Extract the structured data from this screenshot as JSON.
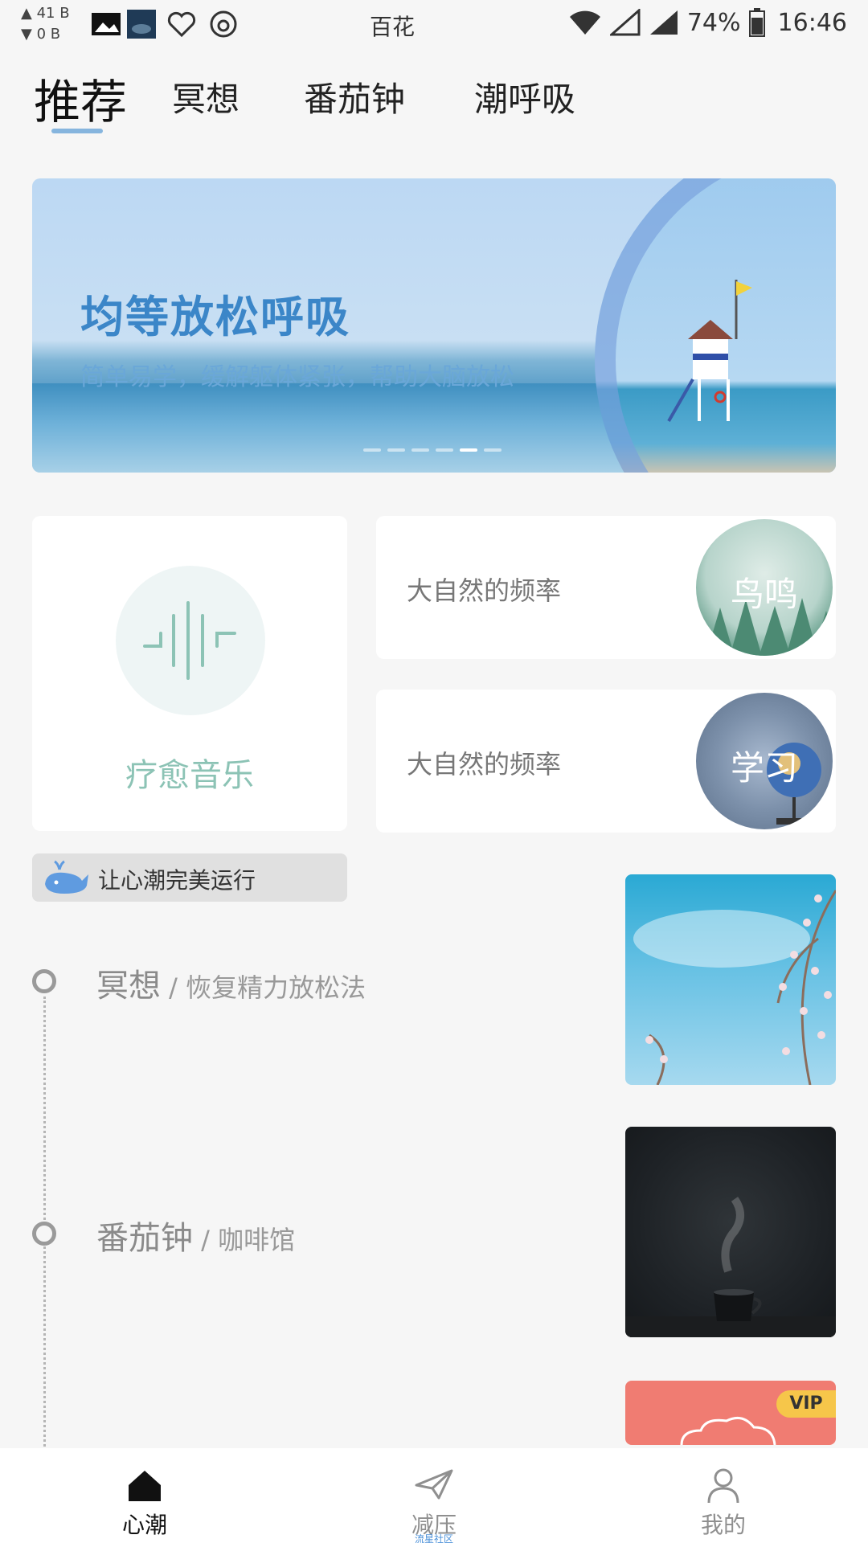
{
  "status_bar": {
    "net_up": "41 B",
    "net_down": "0 B",
    "center_label": "百花",
    "battery": "74%",
    "time": "16:46"
  },
  "tabs": [
    {
      "label": "推荐",
      "active": true
    },
    {
      "label": "冥想",
      "active": false
    },
    {
      "label": "番茄钟",
      "active": false
    },
    {
      "label": "潮呼吸",
      "active": false
    }
  ],
  "banner": {
    "title": "均等放松呼吸",
    "subtitle": "简单易学，缓解躯体紧张，帮助大脑放松",
    "dots_count": 6,
    "active_dot": 4
  },
  "music_card": {
    "label": "疗愈音乐",
    "icon": "soundwave-icon"
  },
  "nature_cards": [
    {
      "title": "大自然的频率",
      "thumb_text": "鸟鸣"
    },
    {
      "title": "大自然的频率",
      "thumb_text": "学习"
    }
  ],
  "tip": {
    "text": "让心潮完美运行",
    "icon": "whale-icon"
  },
  "timeline": [
    {
      "title": "冥想",
      "separator": " / ",
      "subtitle": "恢复精力放松法"
    },
    {
      "title": "番茄钟",
      "separator": " / ",
      "subtitle": "咖啡馆"
    }
  ],
  "vip_badge": "VIP",
  "bottom_nav": [
    {
      "label": "心潮",
      "icon": "home-icon",
      "active": true
    },
    {
      "label": "减压",
      "icon": "paper-plane-icon",
      "active": false,
      "sublabel": "流星社区"
    },
    {
      "label": "我的",
      "icon": "person-icon",
      "active": false
    }
  ],
  "colors": {
    "accent_blue": "#3b86c8",
    "music_green": "#8cc3b5",
    "vip_yellow": "#f6c64a",
    "vip_card": "#f07c72"
  }
}
